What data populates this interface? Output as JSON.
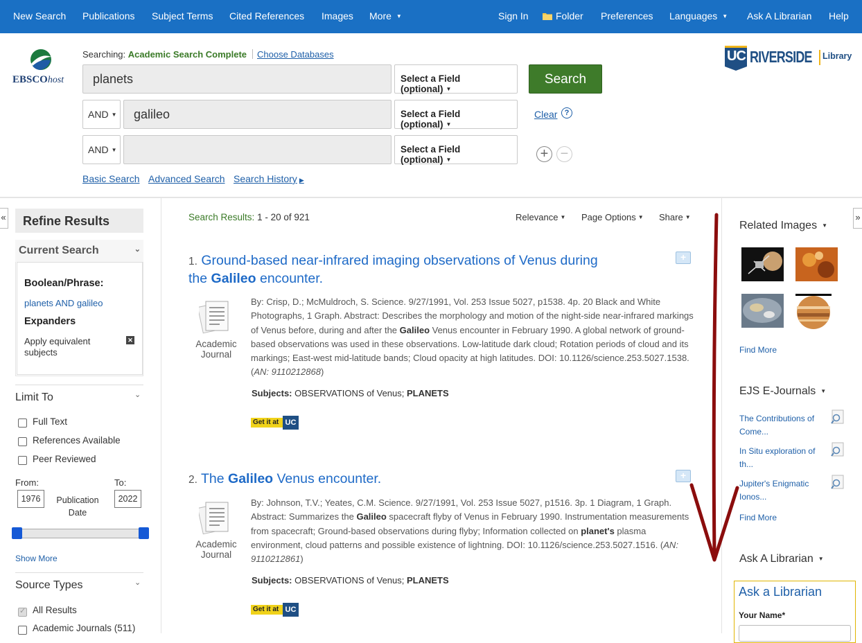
{
  "topnav": {
    "left": [
      "New Search",
      "Publications",
      "Subject Terms",
      "Cited References",
      "Images",
      "More"
    ],
    "right": [
      "Sign In",
      "Folder",
      "Preferences",
      "Languages",
      "Ask A Librarian",
      "Help"
    ]
  },
  "brand": {
    "logo": "EBSCOhost",
    "logo_colors": [
      "#1b7a3e",
      "#1e5ca5"
    ]
  },
  "header": {
    "searching_label": "Searching:",
    "database": "Academic Search Complete",
    "choose_databases": "Choose Databases",
    "rows": [
      {
        "bool": "",
        "value": "planets",
        "field": "Select a Field (optional)"
      },
      {
        "bool": "AND",
        "value": "galileo",
        "field": "Select a Field (optional)"
      },
      {
        "bool": "AND",
        "value": "",
        "field": "Select a Field (optional)"
      }
    ],
    "search_button": "Search",
    "clear": "Clear",
    "help_icon": "?",
    "links": [
      "Basic Search",
      "Advanced Search",
      "Search History"
    ]
  },
  "library_logo": {
    "uc": "UC",
    "name": "RIVERSIDE",
    "tag": "Library",
    "color": "#1f4f84",
    "accent": "#f0b51a"
  },
  "left": {
    "refine_title": "Refine Results",
    "current_search": "Current Search",
    "boolean_label": "Boolean/Phrase:",
    "boolean_value": "planets AND galileo",
    "expanders_label": "Expanders",
    "expander_value": "Apply equivalent subjects",
    "limit_to": "Limit To",
    "limits": [
      "Full Text",
      "References Available",
      "Peer Reviewed"
    ],
    "from_label": "From:",
    "to_label": "To:",
    "from_year": "1976",
    "to_year": "2022",
    "pub_date_label": "Publication Date",
    "show_more": "Show More",
    "source_types": "Source Types",
    "sources": [
      {
        "label": "All Results",
        "checked": true
      },
      {
        "label": "Academic Journals (511)",
        "checked": false
      }
    ],
    "collapse_left": "«"
  },
  "results": {
    "label": "Search Results:",
    "range": "1 - 20 of 921",
    "sort": [
      "Relevance",
      "Page Options",
      "Share"
    ],
    "items": [
      {
        "num": "1.",
        "title_a": "Ground-based near-infrared imaging observations of Venus during",
        "title_b": "the ",
        "title_bold": "Galileo",
        "title_c": " encounter.",
        "type": "Academic Journal",
        "abstract_html": "By: Crisp, D.; McMuldroch, S. Science. 9/27/1991, Vol. 253 Issue 5027, p1538. 4p. 20 Black and White Photographs, 1 Graph. Abstract: Describes the morphology and motion of the night-side near-infrared markings of Venus before, during and after the <b>Galileo</b> Venus encounter in February 1990. A global network of ground-based observations was used in these observations. Low-latitude dark cloud; Rotation periods of cloud and its markings; East-west mid-latitude bands; Cloud opacity at high latitudes. DOI: 10.1126/science.253.5027.1538. (<i>AN: 9110212868</i>)",
        "subjects_label": "Subjects:",
        "subjects": "OBSERVATIONS of Venus;",
        "subjects_bold": "PLANETS",
        "getit": "Get it at",
        "getit_uc": "UC"
      },
      {
        "num": "2.",
        "title_a": "The ",
        "title_bold": "Galileo",
        "title_c": " Venus encounter.",
        "type": "Academic Journal",
        "abstract_html": "By: Johnson, T.V.; Yeates, C.M. Science. 9/27/1991, Vol. 253 Issue 5027, p1516. 3p. 1 Diagram, 1 Graph. Abstract: Summarizes the <b>Galileo</b> spacecraft flyby of Venus in February 1990. Instrumentation measurements from spacecraft; Ground-based observations during flyby; Information collected on <b>planet's</b> plasma environment, cloud patterns and possible existence of lightning. DOI: 10.1126/science.253.5027.1516. (<i>AN: 9110212861</i>)",
        "subjects_label": "Subjects:",
        "subjects": "OBSERVATIONS of Venus;",
        "subjects_bold": "PLANETS",
        "getit": "Get it at",
        "getit_uc": "UC"
      }
    ]
  },
  "right": {
    "related_images": "Related Images",
    "find_more_1": "Find More",
    "ejs": "EJS E-Journals",
    "journals": [
      "The Contributions of Come...",
      "In Situ exploration of th...",
      "Jupiter's Enigmatic Ionos..."
    ],
    "find_more_2": "Find More",
    "ask": "Ask A Librarian",
    "ask_box_title": "Ask a Librarian",
    "your_name": "Your Name*",
    "collapse_right": "»"
  },
  "annotation": {
    "arrow_color": "#8b0d0d"
  }
}
